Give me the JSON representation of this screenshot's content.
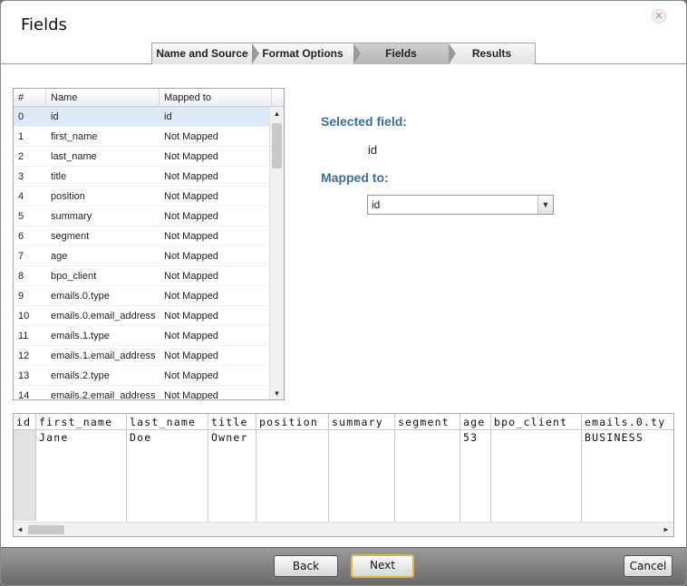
{
  "window": {
    "title": "Fields",
    "close_icon": "close-icon"
  },
  "wizard": {
    "steps": [
      {
        "label": "Name and Source",
        "active": false
      },
      {
        "label": "Format Options",
        "active": false
      },
      {
        "label": "Fields",
        "active": true
      },
      {
        "label": "Results",
        "active": false
      }
    ]
  },
  "fields_grid": {
    "headers": [
      "#",
      "Name",
      "Mapped to"
    ],
    "rows": [
      {
        "num": "0",
        "name": "id",
        "mapped": "id",
        "selected": true
      },
      {
        "num": "1",
        "name": "first_name",
        "mapped": "Not Mapped"
      },
      {
        "num": "2",
        "name": "last_name",
        "mapped": "Not Mapped"
      },
      {
        "num": "3",
        "name": "title",
        "mapped": "Not Mapped"
      },
      {
        "num": "4",
        "name": "position",
        "mapped": "Not Mapped"
      },
      {
        "num": "5",
        "name": "summary",
        "mapped": "Not Mapped"
      },
      {
        "num": "6",
        "name": "segment",
        "mapped": "Not Mapped"
      },
      {
        "num": "7",
        "name": "age",
        "mapped": "Not Mapped"
      },
      {
        "num": "8",
        "name": "bpo_client",
        "mapped": "Not Mapped"
      },
      {
        "num": "9",
        "name": "emails.0.type",
        "mapped": "Not Mapped"
      },
      {
        "num": "10",
        "name": "emails.0.email_address",
        "mapped": "Not Mapped"
      },
      {
        "num": "11",
        "name": "emails.1.type",
        "mapped": "Not Mapped"
      },
      {
        "num": "12",
        "name": "emails.1.email_address",
        "mapped": "Not Mapped"
      },
      {
        "num": "13",
        "name": "emails.2.type",
        "mapped": "Not Mapped"
      },
      {
        "num": "14",
        "name": "emails.2.email_address",
        "mapped": "Not Mapped"
      }
    ]
  },
  "details": {
    "selected_label": "Selected field:",
    "selected_value": "id",
    "mapped_label": "Mapped to:",
    "mapped_value": "id"
  },
  "preview": {
    "columns": [
      "id",
      "first_name",
      "last_name",
      "title",
      "position",
      "summary",
      "segment",
      "age",
      "bpo_client",
      "emails.0.ty"
    ],
    "row": [
      "",
      "Jane",
      "Doe",
      "Owner",
      "",
      "",
      "",
      "53",
      "",
      "BUSINESS"
    ]
  },
  "footer": {
    "back": "Back",
    "next": "Next",
    "cancel": "Cancel"
  }
}
